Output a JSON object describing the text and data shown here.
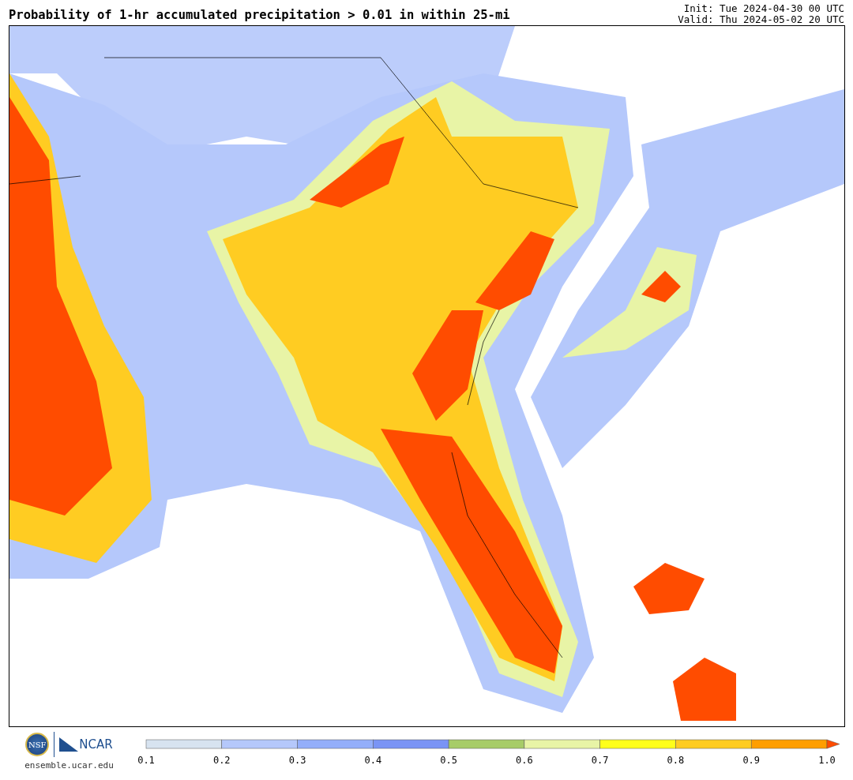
{
  "title": "Probability of 1-hr accumulated precipitation > 0.01 in within 25-mi",
  "init": "Init: Tue 2024-04-30 00 UTC",
  "valid": "Valid: Thu 2024-05-02 20 UTC",
  "logos": {
    "nsf": "NSF",
    "ncar": "NCAR",
    "url": "ensemble.ucar.edu"
  },
  "colorbar": {
    "bins": [
      {
        "color": "#d7e3f0"
      },
      {
        "color": "#b5c8fb"
      },
      {
        "color": "#93aefa"
      },
      {
        "color": "#7a94f5"
      },
      {
        "color": "#a7cc68"
      },
      {
        "color": "#e8f4a6"
      },
      {
        "color": "#ffff1a"
      },
      {
        "color": "#ffcc22"
      },
      {
        "color": "#ff9e00"
      },
      {
        "color": "#ff4c00",
        "kind": "arrow"
      }
    ],
    "ticks": [
      "0.1",
      "0.2",
      "0.3",
      "0.4",
      "0.5",
      "0.6",
      "0.7",
      "0.8",
      "0.9",
      "1.0"
    ]
  }
}
